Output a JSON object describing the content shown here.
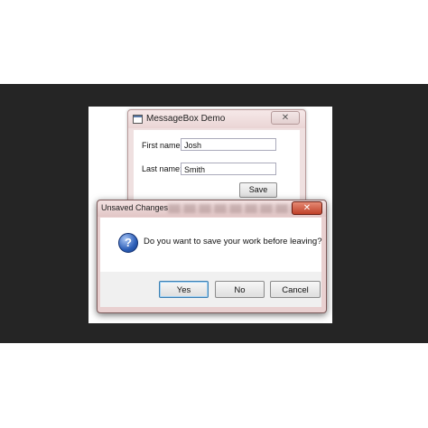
{
  "main_window": {
    "title": "MessageBox Demo",
    "close_glyph": "✕",
    "first_name_label": "First name:",
    "first_name_value": "Josh",
    "last_name_label": "Last name:",
    "last_name_value": "Smith",
    "save_label": "Save"
  },
  "dialog": {
    "title": "Unsaved Changes",
    "close_glyph": "✕",
    "icon": "question-icon",
    "icon_glyph": "?",
    "message": "Do you want to save your work before leaving?",
    "buttons": {
      "yes": "Yes",
      "no": "No",
      "cancel": "Cancel"
    }
  },
  "colors": {
    "backdrop": "#252525",
    "close_button": "#c9462f",
    "question_icon": "#2d5fb8"
  }
}
